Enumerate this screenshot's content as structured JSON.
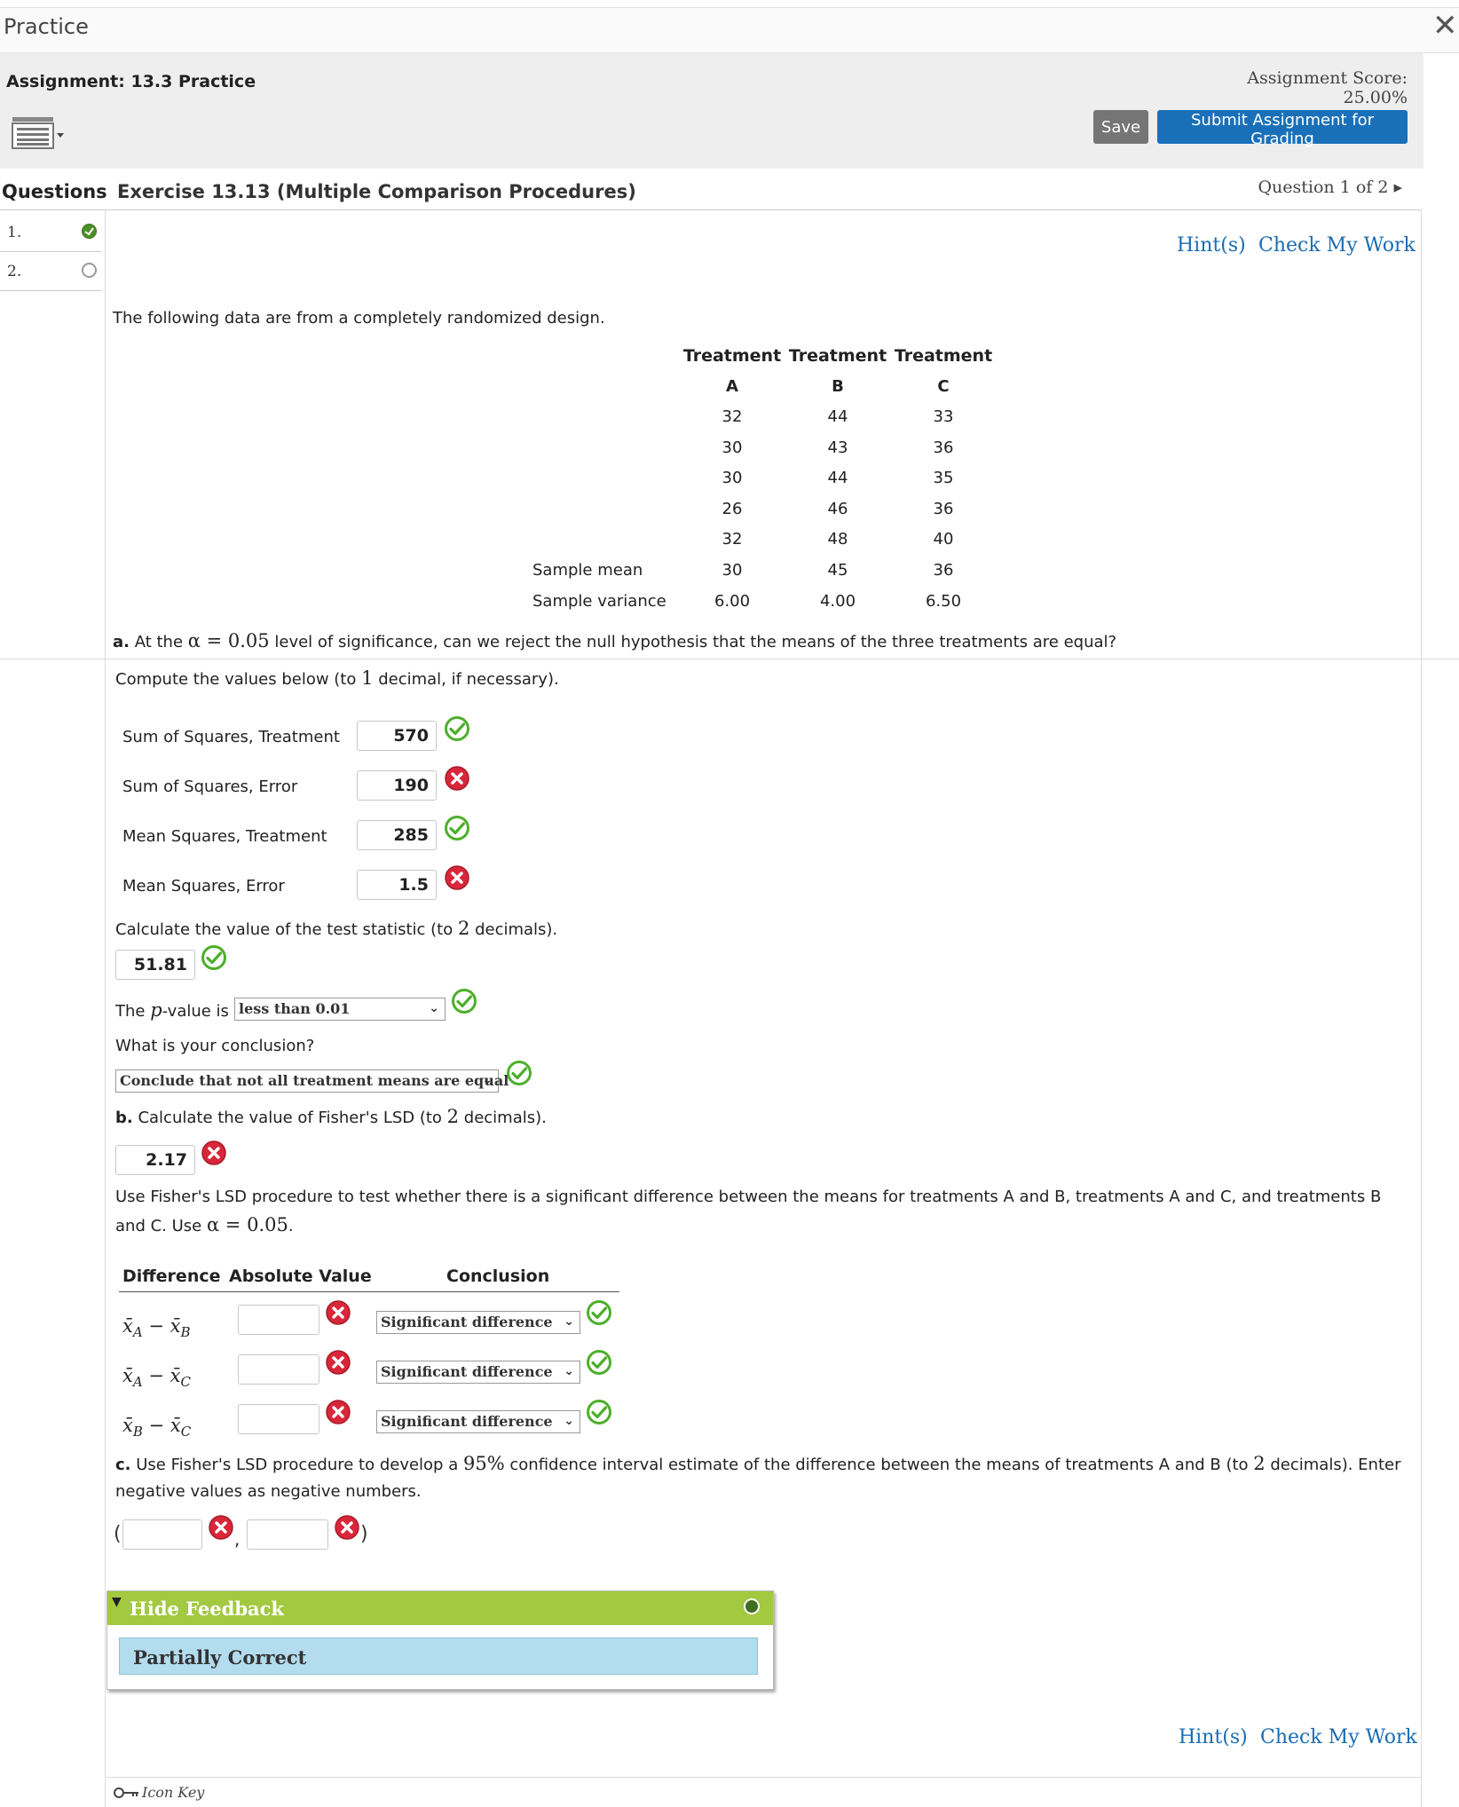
{
  "window": {
    "title": "Practice",
    "close_glyph": "✕"
  },
  "header": {
    "assignment_label": "Assignment: 13.3 Practice",
    "score": "Assignment Score: 25.00%",
    "save_label": "Save",
    "submit_label": "Submit Assignment for Grading"
  },
  "questions_bar": {
    "label": "Questions",
    "exercise_title": "Exercise 13.13 (Multiple Comparison Procedures)",
    "nav": "Question 1 of 2 ▸"
  },
  "sidebar": {
    "items": [
      {
        "label": "1.",
        "status": "partially-correct"
      },
      {
        "label": "2.",
        "status": "not-attempted"
      }
    ]
  },
  "links": {
    "hints": "Hint(s)",
    "check": "Check My Work"
  },
  "problem": {
    "intro": "The following data are from a completely randomized design.",
    "table": {
      "headers": [
        "Treatment",
        "Treatment",
        "Treatment"
      ],
      "subheaders": [
        "A",
        "B",
        "C"
      ],
      "rows": [
        [
          "32",
          "44",
          "33"
        ],
        [
          "30",
          "43",
          "36"
        ],
        [
          "30",
          "44",
          "35"
        ],
        [
          "26",
          "46",
          "36"
        ],
        [
          "32",
          "48",
          "40"
        ]
      ],
      "mean_label": "Sample mean",
      "means": [
        "30",
        "45",
        "36"
      ],
      "variance_label": "Sample variance",
      "variances": [
        "6.00",
        "4.00",
        "6.50"
      ]
    }
  },
  "part_a": {
    "question_prefix": "a.",
    "question_pre": " At the ",
    "alpha_expr": "α = 0.05",
    "question_post": " level of significance, can we reject the null hypothesis that the means of the three treatments are equal?",
    "compute_pre": "Compute the values below (to ",
    "compute_num": "1",
    "compute_post": " decimal, if necessary).",
    "fields": [
      {
        "label": "Sum of Squares, Treatment",
        "value": "570",
        "correct": true
      },
      {
        "label": "Sum of Squares, Error",
        "value": "190",
        "correct": false
      },
      {
        "label": "Mean Squares, Treatment",
        "value": "285",
        "correct": true
      },
      {
        "label": "Mean Squares, Error",
        "value": "1.5",
        "correct": false
      }
    ],
    "test_stat_pre": "Calculate the value of the test statistic (to ",
    "test_stat_num": "2",
    "test_stat_post": " decimals).",
    "test_stat_value": "51.81",
    "pvalue_pre": "The ",
    "pvalue_var": "p",
    "pvalue_post": "-value is",
    "pvalue_selected": "less than 0.01",
    "conclusion_question": "What is your conclusion?",
    "conclusion_selected": "Conclude that not all treatment means are equal"
  },
  "part_b": {
    "prefix": "b.",
    "text_pre": " Calculate the value of Fisher's LSD (to ",
    "text_num": "2",
    "text_post": " decimals).",
    "lsd_value": "2.17",
    "instructions_line1": "Use Fisher's LSD procedure to test whether there is a significant difference between the means for treatments A and B, treatments A and C, and treatments B",
    "instructions_line2_pre": "and C. Use ",
    "instructions_alpha": "α = 0.05",
    "instructions_line2_post": ".",
    "table_headers": [
      "Difference",
      "Absolute Value",
      "Conclusion"
    ],
    "rows": [
      {
        "diff_a": "x̄",
        "sub_a": "A",
        "diff_b": "x̄",
        "sub_b": "B",
        "value": "",
        "conclusion": "Significant difference"
      },
      {
        "diff_a": "x̄",
        "sub_a": "A",
        "diff_b": "x̄",
        "sub_b": "C",
        "value": "",
        "conclusion": "Significant difference"
      },
      {
        "diff_a": "x̄",
        "sub_a": "B",
        "diff_b": "x̄",
        "sub_b": "C",
        "value": "",
        "conclusion": "Significant difference"
      }
    ],
    "minus": "−"
  },
  "part_c": {
    "prefix": "c.",
    "text_pre": " Use Fisher's LSD procedure to develop a ",
    "text_pct": "95%",
    "text_mid": " confidence interval estimate of the difference between the means of treatments A and B (to ",
    "text_num": "2",
    "text_post": " decimals). Enter",
    "text_line2": "negative values as negative numbers.",
    "open_paren": "(",
    "comma": ",",
    "close_paren": ")",
    "lower": "",
    "upper": ""
  },
  "feedback": {
    "toggle_label": "Hide Feedback",
    "status": "Partially Correct"
  },
  "footer": {
    "icon_key": "Icon Key"
  },
  "colors": {
    "correct": "#4caf2a",
    "incorrect": "#d9263a",
    "feedback_bar": "#a2c940",
    "primary": "#1a70b8"
  }
}
